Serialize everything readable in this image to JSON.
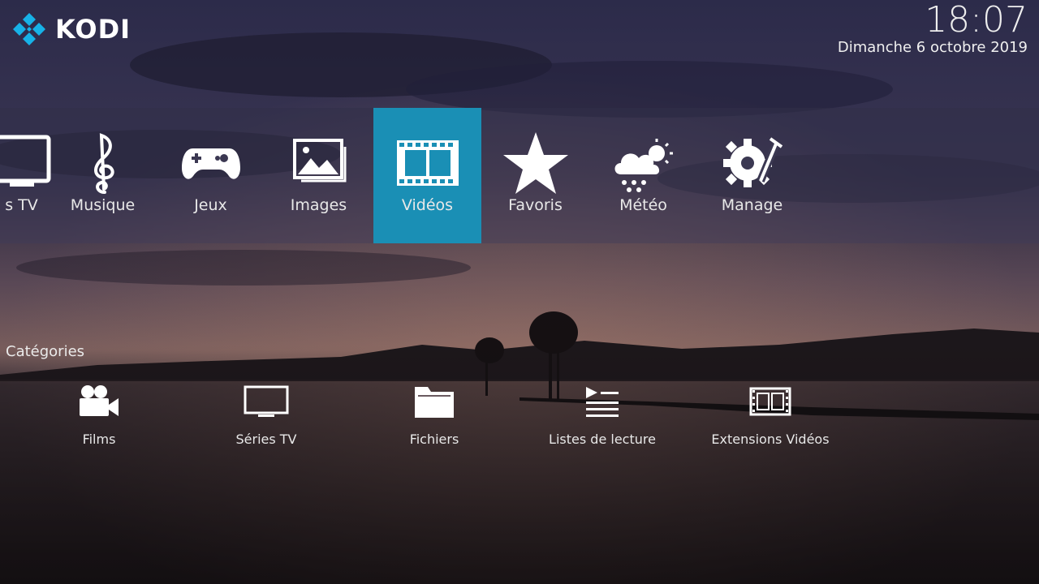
{
  "header": {
    "brand": "KODI",
    "time": "18:07",
    "date": "Dimanche 6 octobre 2019"
  },
  "menu": {
    "items": [
      {
        "label": "s TV",
        "icon": "tv-icon"
      },
      {
        "label": "Musique",
        "icon": "music-icon"
      },
      {
        "label": "Jeux",
        "icon": "gamepad-icon"
      },
      {
        "label": "Images",
        "icon": "images-icon"
      },
      {
        "label": "Vidéos",
        "icon": "film-icon",
        "active": true
      },
      {
        "label": "Favoris",
        "icon": "star-icon"
      },
      {
        "label": "Météo",
        "icon": "weather-icon"
      },
      {
        "label": "Manage",
        "icon": "manage-icon"
      }
    ]
  },
  "categories": {
    "title": "Catégories",
    "items": [
      {
        "label": "Films",
        "icon": "video-camera-icon"
      },
      {
        "label": "Séries TV",
        "icon": "tv-icon"
      },
      {
        "label": "Fichiers",
        "icon": "folder-icon"
      },
      {
        "label": "Listes de lecture",
        "icon": "playlist-icon"
      },
      {
        "label": "Extensions Vidéos",
        "icon": "film-icon"
      }
    ]
  },
  "colors": {
    "accent": "#1a8fb5"
  }
}
